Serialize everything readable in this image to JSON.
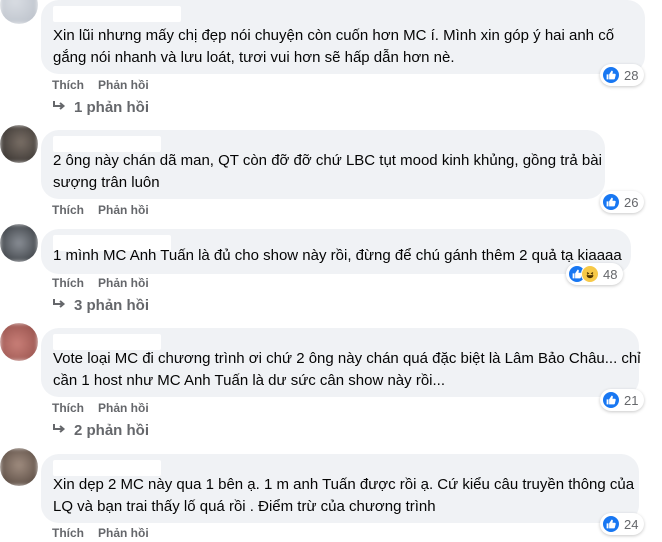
{
  "comments": [
    {
      "lines": [
        "Xin lũi nhưng mấy chị đẹp nói chuyện còn cuốn hơn MC í. Mình xin góp ý hai anh cố",
        "gắng nói nhanh và lưu loát, tươi vui hơn sẽ hấp dẫn hơn nè."
      ],
      "like_label": "Thích",
      "reply_label": "Phản hồi",
      "reaction_count": "28",
      "reactions": [
        "like-icon"
      ],
      "replies_label": "1 phản hồi"
    },
    {
      "lines": [
        "2 ông này chán dã man, QT còn đỡ đỡ chứ LBC tụt mood kinh khủng, gồng trả bài",
        "sượng trân luôn"
      ],
      "like_label": "Thích",
      "reply_label": "Phản hồi",
      "reaction_count": "26",
      "reactions": [
        "like-icon"
      ]
    },
    {
      "lines": [
        "1 mình MC Anh Tuấn là đủ cho show này rồi, đừng để chú gánh thêm 2 quả tạ kiaaaa"
      ],
      "like_label": "Thích",
      "reply_label": "Phản hồi",
      "reaction_count": "48",
      "reactions": [
        "like-icon",
        "haha-icon"
      ],
      "replies_label": "3 phản hồi"
    },
    {
      "lines": [
        "Vote loại MC đi chương trình ơi chứ 2 ông này chán quá đặc biệt là Lâm Bảo Châu... chỉ",
        "cần 1 host như MC Anh Tuấn là dư sức cân show này rồi..."
      ],
      "like_label": "Thích",
      "reply_label": "Phản hồi",
      "reaction_count": "21",
      "reactions": [
        "like-icon"
      ],
      "replies_label": "2 phản hồi"
    },
    {
      "lines": [
        "Xin dẹp 2 MC này qua 1 bên ạ. 1 m anh Tuấn được rồi ạ. Cứ kiểu câu truyền thông của",
        "LQ và bạn trai thấy lố quá rồi . Điểm trừ của chương trình"
      ],
      "like_label": "Thích",
      "reply_label": "Phản hồi",
      "reaction_count": "24",
      "reactions": [
        "like-icon"
      ]
    }
  ],
  "colors": {
    "bubble": "#f0f2f5",
    "meta": "#65676b",
    "like": "#1877f2",
    "haha": "#f7c948",
    "text": "#050505"
  }
}
